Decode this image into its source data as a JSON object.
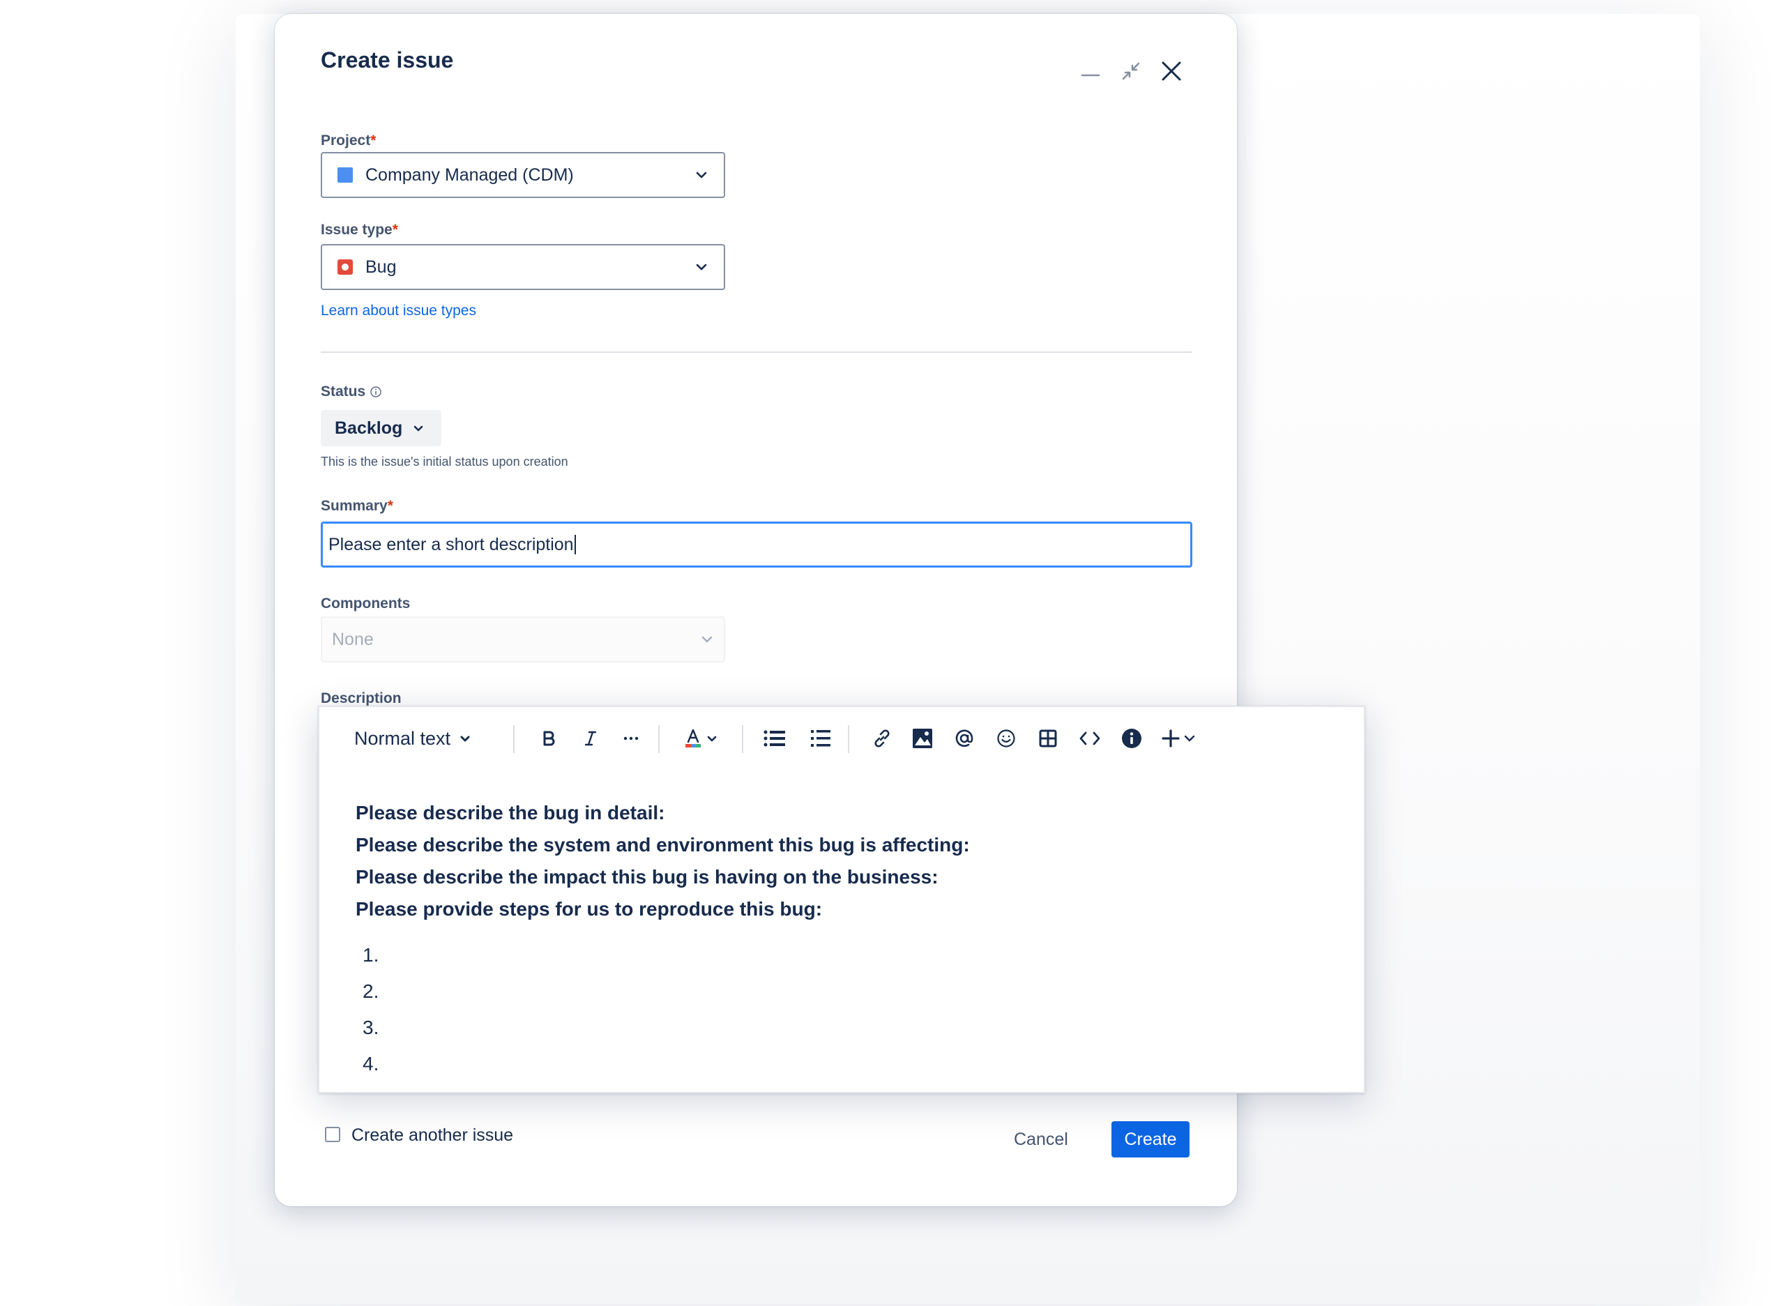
{
  "dialog": {
    "title": "Create issue",
    "controls": {
      "minimize": "minimize-icon",
      "collapse": "collapse-arrows-icon",
      "close": "close-icon"
    }
  },
  "project": {
    "label": "Project",
    "required_mark": "*",
    "value": "Company Managed (CDM)",
    "icon": "project-square-icon",
    "icon_color": "#4c8ff0"
  },
  "issue_type": {
    "label": "Issue type",
    "required_mark": "*",
    "value": "Bug",
    "icon": "bug-icon",
    "icon_color": "#e5493a",
    "link": "Learn about issue types"
  },
  "status": {
    "label": "Status",
    "value": "Backlog",
    "hint": "This is the issue's initial status upon creation"
  },
  "summary": {
    "label": "Summary",
    "required_mark": "*",
    "value": "Please enter a short description"
  },
  "components": {
    "label": "Components",
    "value": "None"
  },
  "description": {
    "label": "Description",
    "toolbar": {
      "text_style": "Normal text",
      "buttons": [
        "bold-icon",
        "italic-icon",
        "more-formatting-icon",
        "text-color-icon",
        "bullet-list-icon",
        "numbered-list-icon",
        "link-icon",
        "image-icon",
        "mention-icon",
        "emoji-icon",
        "table-icon",
        "code-icon",
        "info-icon",
        "insert-plus-icon"
      ]
    },
    "lines": [
      "Please describe the bug in detail:",
      "Please describe the system and environment this bug is affecting:",
      "Please describe the impact this bug is having on the business:",
      "Please provide steps for us to reproduce this bug:"
    ],
    "steps": [
      "1.",
      "2.",
      "3.",
      "4."
    ]
  },
  "footer": {
    "create_another_label": "Create another issue",
    "create_another_checked": false,
    "cancel_label": "Cancel",
    "create_label": "Create"
  },
  "colors": {
    "primary": "#0c66e4",
    "focus_border": "#388bff",
    "required": "#de350b"
  }
}
